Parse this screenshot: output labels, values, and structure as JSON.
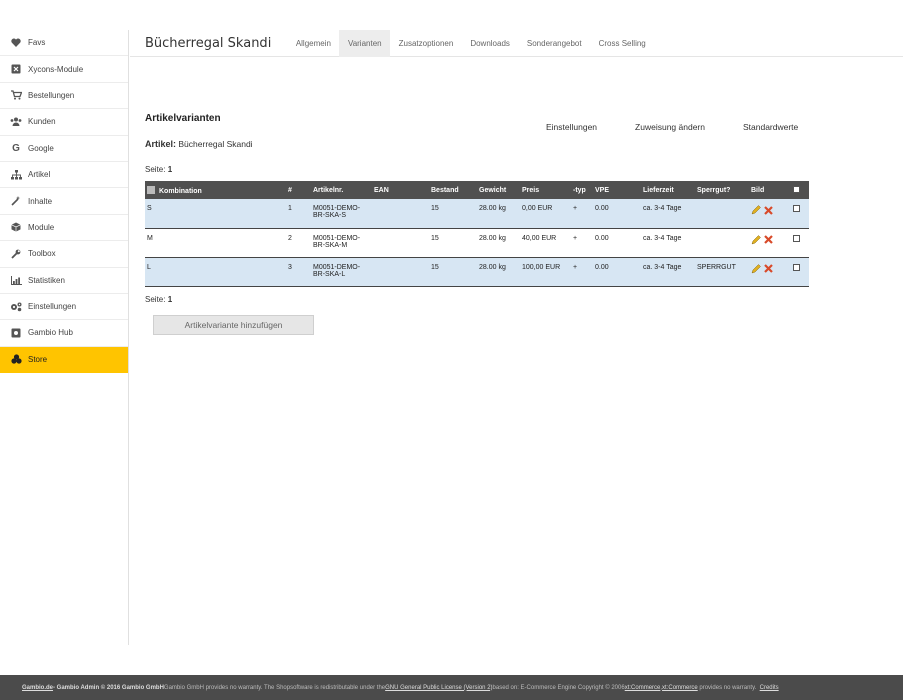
{
  "sidebar": {
    "items": [
      {
        "label": "Favs",
        "icon": "heart-icon"
      },
      {
        "label": "Xycons-Module",
        "icon": "puzzle-icon"
      },
      {
        "label": "Bestellungen",
        "icon": "cart-icon"
      },
      {
        "label": "Kunden",
        "icon": "users-icon"
      },
      {
        "label": "Google",
        "icon": "google-icon"
      },
      {
        "label": "Artikel",
        "icon": "sitemap-icon"
      },
      {
        "label": "Inhalte",
        "icon": "magic-icon"
      },
      {
        "label": "Module",
        "icon": "cube-icon"
      },
      {
        "label": "Toolbox",
        "icon": "wrench-icon"
      },
      {
        "label": "Statistiken",
        "icon": "chart-icon"
      },
      {
        "label": "Einstellungen",
        "icon": "gears-icon"
      },
      {
        "label": "Gambio Hub",
        "icon": "hub-icon"
      },
      {
        "label": "Store",
        "icon": "store-icon",
        "active": true
      }
    ],
    "active_color": "#ffc400"
  },
  "header": {
    "title": "Bücherregal Skandi",
    "tabs": [
      "Allgemein",
      "Varianten",
      "Zusatzoptionen",
      "Downloads",
      "Sonderangebot",
      "Cross Selling"
    ],
    "active_tab": "Varianten"
  },
  "main": {
    "heading": "Artikelvarianten",
    "actions": [
      "Einstellungen",
      "Zuweisung ändern",
      "Standardwerte"
    ],
    "article_label": "Artikel:",
    "article_name": "Bücherregal Skandi",
    "page_label": "Seite:",
    "page_number": "1",
    "table": {
      "headers": [
        "Kombination",
        "#",
        "Artikelnr.",
        "EAN",
        "Bestand",
        "Gewicht",
        "Preis",
        "-typ",
        "VPE",
        "Lieferzeit",
        "Sperrgut?",
        "Bild"
      ],
      "rows": [
        {
          "kombination": "S",
          "nr": "1",
          "artikelnr": "M0051-DEMO-BR-SKA-S",
          "ean": "",
          "bestand": "15",
          "gewicht": "28.00 kg",
          "preis": "0,00 EUR",
          "typ": "+",
          "vpe": "0.00",
          "lieferzeit": "ca. 3-4 Tage",
          "sperrgut": ""
        },
        {
          "kombination": "M",
          "nr": "2",
          "artikelnr": "M0051-DEMO-BR-SKA-M",
          "ean": "",
          "bestand": "15",
          "gewicht": "28.00 kg",
          "preis": "40,00 EUR",
          "typ": "+",
          "vpe": "0.00",
          "lieferzeit": "ca. 3-4 Tage",
          "sperrgut": ""
        },
        {
          "kombination": "L",
          "nr": "3",
          "artikelnr": "M0051-DEMO-BR-SKA-L",
          "ean": "",
          "bestand": "15",
          "gewicht": "28.00 kg",
          "preis": "100,00 EUR",
          "typ": "+",
          "vpe": "0.00",
          "lieferzeit": "ca. 3-4 Tage",
          "sperrgut": "SPERRGUT"
        }
      ]
    },
    "add_button": "Artikelvariante hinzufügen"
  },
  "footer": {
    "brand_link": "Gambio.de",
    "copyright": " - Gambio Admin © 2016 Gambio GmbH",
    "text1": " Gambio GmbH provides no warranty. The Shopsoftware is redistributable under the ",
    "license_link": "GNU General Public License (Version 2)",
    "text2": " based on: E-Commerce Engine Copyright © 2006 ",
    "xtc_link1": "xt:Commerce",
    "text3": ", ",
    "xtc_link2": "xt:Commerce",
    "text4": " provides no warranty.  ",
    "credits_link": "Credits"
  }
}
